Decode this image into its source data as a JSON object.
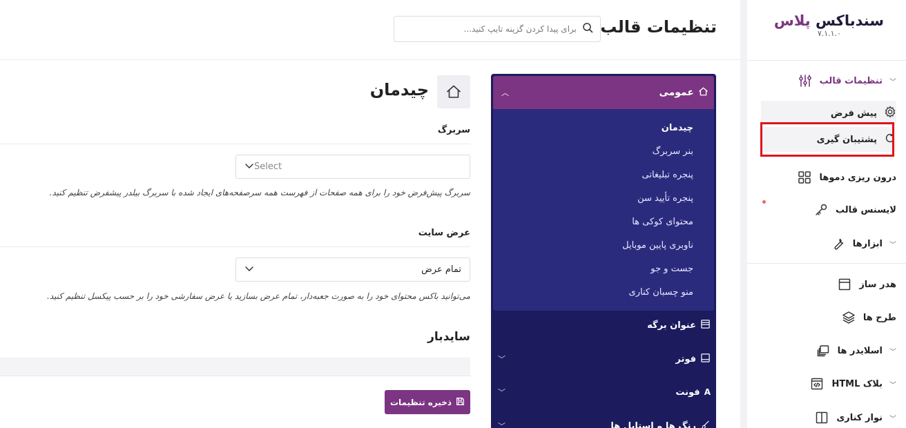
{
  "brand": {
    "name_main": "سندباکس",
    "name_accent": "پلاس",
    "version": "۷.۱.۱.۰"
  },
  "sidebar": {
    "theme_settings": "تنظیمات قالب",
    "default": "پیش فرض",
    "backup": "پشتیبان گیری",
    "demo_import": "درون ریزی دموها",
    "license": "لایسنس قالب",
    "tools": "ابزارها",
    "header_builder": "هدر ساز",
    "layouts": "طرح ها",
    "sliders": "اسلایدر ها",
    "html_block": "بلاک HTML",
    "side_bar": "نوار کناری"
  },
  "header": {
    "title": "تنظیمات قالب",
    "search_placeholder": "برای پیدا کردن گزینه تایپ کنید..."
  },
  "menu": {
    "general": "عمومی",
    "sub": [
      "چیدمان",
      "بنر سربرگ",
      "پنجره تبلیغاتی",
      "پنجره تأیید سن",
      "محتوای کوکی ها",
      "ناوبری پایین موبایل",
      "جست و جو",
      "منو چسبان کناری"
    ],
    "page_title": "عنوان برگه",
    "footer": "فوتر",
    "font": "فونت",
    "colors": "رنگ ها و استایل ها"
  },
  "content": {
    "section_title": "چیدمان",
    "header_label": "سربرگ",
    "header_select": "Select",
    "header_desc": "سربرگ پیش‌فرض خود را برای همه صفحات از فهرست همه سرصفحه‌های ایجاد شده با سربرگ بیلدر پیشفرض تنظیم کنید.",
    "width_label": "عرض سایت",
    "width_select": "تمام عرض",
    "width_desc": "می‌توانید باکس محتوای خود را به صورت جعبه‌دار، تمام عرض بسازید یا عرض سفارشی خود را بر حسب پیکسل تنظیم کنید.",
    "sidebar_title": "سایدبار",
    "save_label": "ذخیره تنظیمات"
  },
  "colors": {
    "accent": "#7b3582",
    "menu_dark": "#1b1b5e",
    "menu_open": "#2b2b7e",
    "highlight": "#e0141b"
  },
  "icons": {
    "sliders": "sliders-icon",
    "gear": "gear-icon",
    "refresh": "refresh-icon",
    "grid": "grid-icon",
    "key": "key-icon",
    "wrench": "wrench-icon",
    "layout": "layout-icon",
    "layers": "layers-icon",
    "copy": "copy-icon",
    "code": "code-icon",
    "sidebar": "sidebar-icon",
    "home": "home-icon",
    "search": "search-icon",
    "save": "save-icon"
  }
}
